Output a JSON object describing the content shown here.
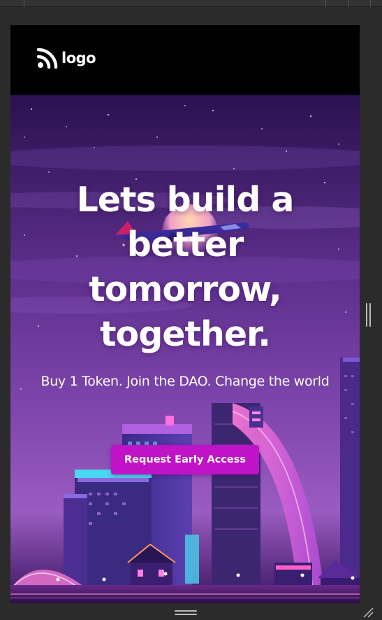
{
  "navbar": {
    "logo_icon": "rss-feed-icon",
    "logo_text": "logo"
  },
  "hero": {
    "title": "Lets build a better tomorrow, together.",
    "subtitle": "Buy 1 Token. Join the DAO. Change the world",
    "cta_label": "Request Early Access"
  },
  "colors": {
    "navbar_background": "#000000",
    "cta_background": "#c012c6",
    "hero_text": "#ffffff",
    "sky_top": "#2a1150",
    "sky_mid": "#5d2f8c",
    "sky_horizon": "#9a5cc0",
    "editor_chrome": "#2b2b2b"
  }
}
